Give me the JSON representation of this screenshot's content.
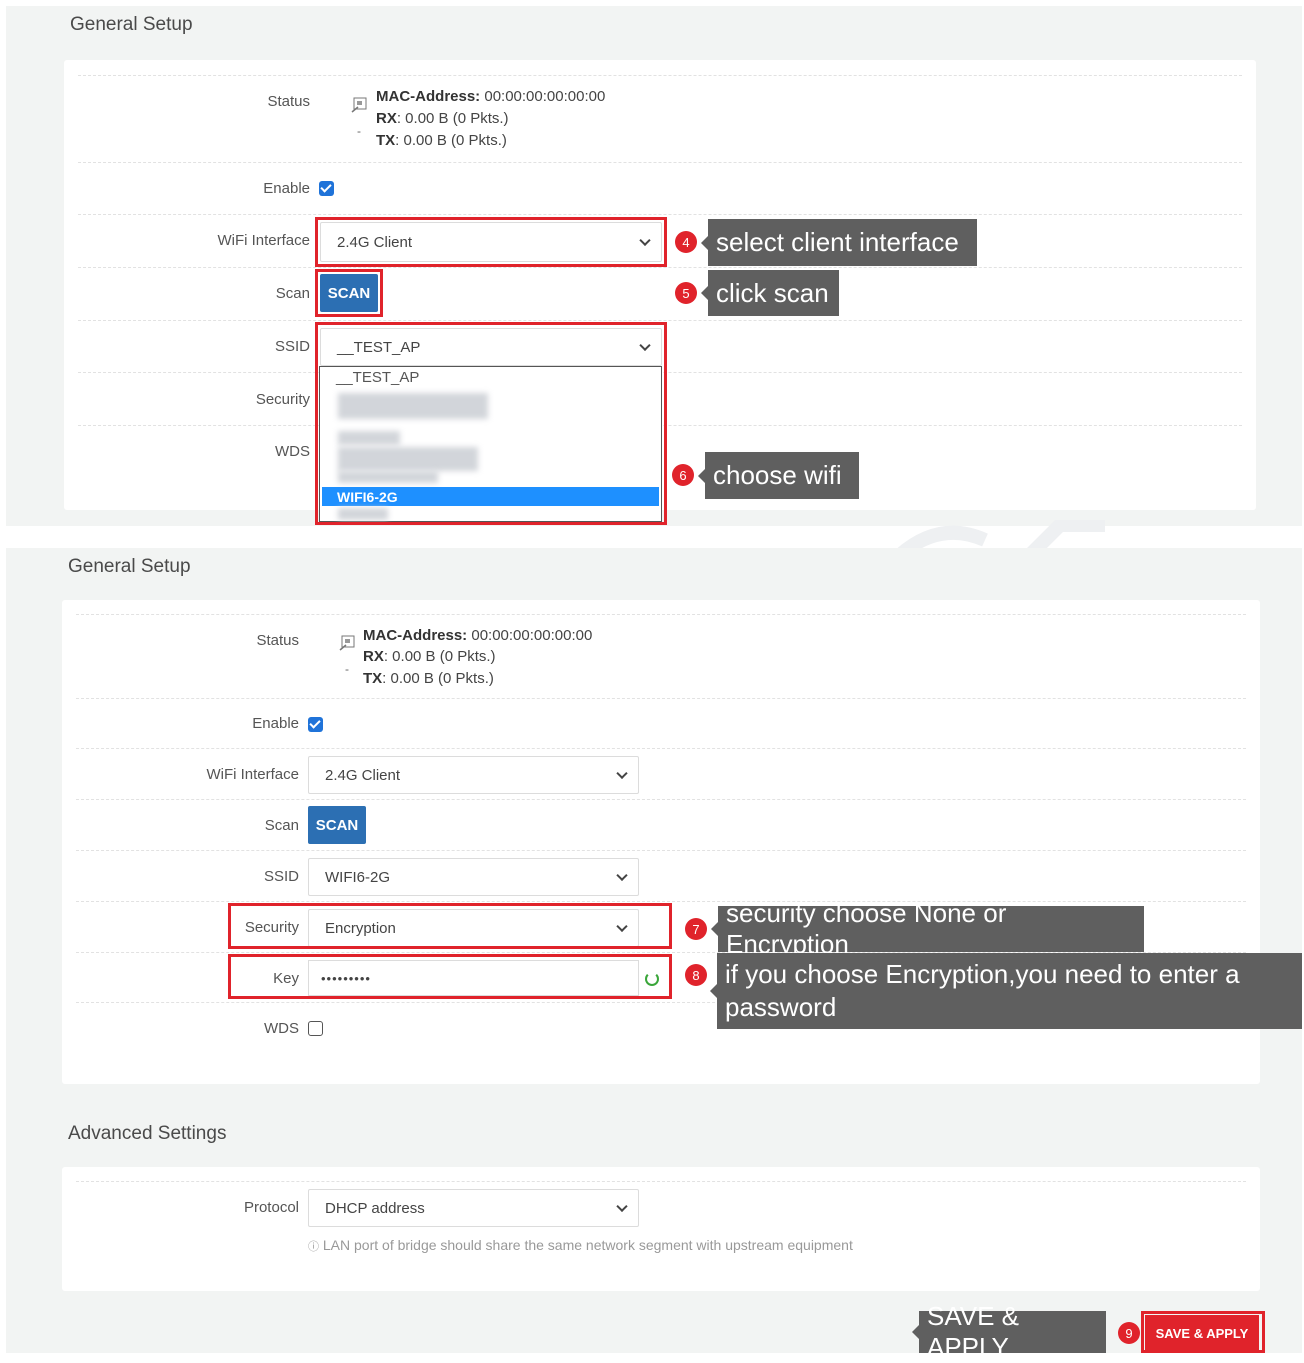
{
  "top": {
    "section_title": "General Setup",
    "status": {
      "label": "Status",
      "mac_label": "MAC-Address:",
      "mac_value": " 00:00:00:00:00:00",
      "rx_label": "RX",
      "rx_value": ": 0.00 B (0 Pkts.)",
      "tx_label": "TX",
      "tx_value": ": 0.00 B (0 Pkts.)",
      "dash": "-"
    },
    "enable_label": "Enable",
    "wifi_interface_label": "WiFi Interface",
    "wifi_interface_value": "2.4G Client",
    "scan_label": "Scan",
    "scan_button": "SCAN",
    "ssid_label": "SSID",
    "ssid_value": "__TEST_AP",
    "security_label": "Security",
    "wds_label": "WDS",
    "dropdown_items": [
      "__TEST_AP",
      "WIFI6-2G"
    ]
  },
  "bottom": {
    "section_title": "General Setup",
    "status": {
      "label": "Status",
      "mac_label": "MAC-Address:",
      "mac_value": " 00:00:00:00:00:00",
      "rx_label": "RX",
      "rx_value": ": 0.00 B (0 Pkts.)",
      "tx_label": "TX",
      "tx_value": ": 0.00 B (0 Pkts.)",
      "dash": "-"
    },
    "enable_label": "Enable",
    "wifi_interface_label": "WiFi Interface",
    "wifi_interface_value": "2.4G Client",
    "scan_label": "Scan",
    "scan_button": "SCAN",
    "ssid_label": "SSID",
    "ssid_value": "WIFI6-2G",
    "security_label": "Security",
    "security_value": "Encryption",
    "key_label": "Key",
    "key_value": "•••••••••",
    "wds_label": "WDS"
  },
  "advanced": {
    "section_title": "Advanced Settings",
    "protocol_label": "Protocol",
    "protocol_value": "DHCP address",
    "help_text": "LAN port of bridge should share the same network segment with upstream equipment"
  },
  "annotations": {
    "step4": {
      "num": "4",
      "text": "select client interface"
    },
    "step5": {
      "num": "5",
      "text": "click scan"
    },
    "step6": {
      "num": "6",
      "text": "choose wifi"
    },
    "step7": {
      "num": "7",
      "text": "security choose None or Encryption"
    },
    "step8": {
      "num": "8",
      "line1": "if you choose Encryption,you need to enter a",
      "line2": "password"
    },
    "step9": {
      "num": "9",
      "text": "SAVE & APPLY"
    }
  },
  "save_apply_button": "SAVE & APPLY",
  "colors": {
    "accent_blue": "#2c6fb3",
    "annotation_red": "#e0232b",
    "callout_gray": "#5f5f5f",
    "selection_blue": "#1e90ff"
  }
}
